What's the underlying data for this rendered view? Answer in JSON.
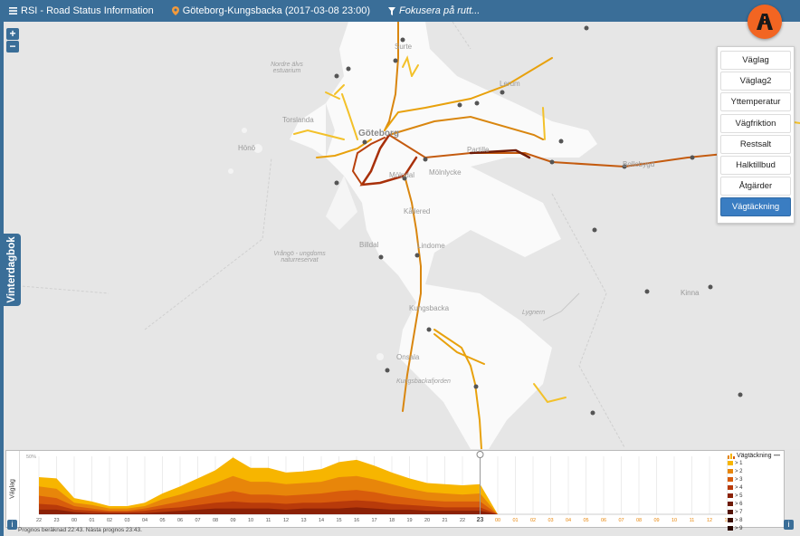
{
  "header": {
    "app_title": "RSI - Road Status Information",
    "location": "Göteborg-Kungsbacka (2017-03-08 23:00)",
    "focus": "Fokusera på rutt..."
  },
  "zoom": {
    "in": "+",
    "out": "−"
  },
  "layers": [
    {
      "label": "Väglag",
      "active": false
    },
    {
      "label": "Väglag2",
      "active": false
    },
    {
      "label": "Yttemperatur",
      "active": false
    },
    {
      "label": "Vägfriktion",
      "active": false
    },
    {
      "label": "Restsalt",
      "active": false
    },
    {
      "label": "Halktillbud",
      "active": false
    },
    {
      "label": "Åtgärder",
      "active": false
    },
    {
      "label": "Vägtäckning",
      "active": true
    }
  ],
  "side_tab": "Vinterdagbok",
  "map_labels": {
    "surte": "Surte",
    "nordre": "Nordre älvs estuarium",
    "lerum": "Lerum",
    "torslanda": "Torslanda",
    "hono": "Hönö",
    "goteborg": "Göteborg",
    "partille": "Partille",
    "mollerud": "Mölndal",
    "molnlycke": "Mölnlycke",
    "bollebygd": "Bollebygd",
    "kallered": "Kållered",
    "billdal": "Billdal",
    "lindome": "Lindome",
    "vrango": "Vrångö - ungdoms naturreservat",
    "kungsbacka": "Kungsbacka",
    "lygnern": "Lygnern",
    "kinna": "Kinna",
    "onsala": "Onsala",
    "kungsbackafjorden": "Kungsbackafjorden"
  },
  "bottom_panel": {
    "side_tab": "Väglag",
    "ymax_label": "50%",
    "current_hour": "23",
    "hours_past": [
      "22",
      "23",
      "00",
      "01",
      "02",
      "03",
      "04",
      "05",
      "06",
      "07",
      "08",
      "09",
      "10",
      "11",
      "12",
      "13",
      "14",
      "15",
      "16",
      "17",
      "18",
      "19",
      "20",
      "21",
      "22",
      "23"
    ],
    "hours_future": [
      "00",
      "01",
      "02",
      "03",
      "04",
      "05",
      "06",
      "07",
      "08",
      "09",
      "10",
      "11",
      "12",
      "13"
    ]
  },
  "chart_data": {
    "type": "area",
    "title": "Vägtäckning",
    "ylim": [
      0,
      50
    ],
    "x": [
      "22",
      "23",
      "00",
      "01",
      "02",
      "03",
      "04",
      "05",
      "06",
      "07",
      "08",
      "09",
      "10",
      "11",
      "12",
      "13",
      "14",
      "15",
      "16",
      "17",
      "18",
      "19",
      "20",
      "21",
      "22",
      "23"
    ],
    "series": [
      {
        "name": "> 1",
        "values": [
          32,
          31,
          14,
          11,
          7,
          7,
          10,
          18,
          24,
          31,
          38,
          49,
          40,
          40,
          36,
          37,
          39,
          45,
          47,
          42,
          36,
          31,
          27,
          26,
          25,
          26
        ]
      },
      {
        "name": "> 2",
        "values": [
          24,
          22,
          10,
          8,
          5,
          5,
          7,
          13,
          17,
          22,
          27,
          33,
          28,
          28,
          26,
          27,
          28,
          32,
          33,
          30,
          26,
          22,
          19,
          18,
          17,
          18
        ]
      },
      {
        "name": "> 3",
        "values": [
          16,
          14,
          7,
          5,
          3,
          3,
          5,
          8,
          11,
          14,
          17,
          20,
          17,
          17,
          16,
          17,
          18,
          20,
          21,
          19,
          16,
          14,
          12,
          11,
          11,
          11
        ]
      },
      {
        "name": "> 4",
        "values": [
          9,
          8,
          4,
          3,
          2,
          2,
          3,
          5,
          6,
          8,
          10,
          11,
          10,
          10,
          9,
          10,
          10,
          11,
          12,
          11,
          9,
          8,
          7,
          6,
          6,
          6
        ]
      },
      {
        "name": "> 5",
        "values": [
          4,
          4,
          2,
          1,
          1,
          1,
          1,
          2,
          3,
          4,
          5,
          5,
          5,
          5,
          4,
          5,
          5,
          5,
          6,
          5,
          4,
          4,
          3,
          3,
          3,
          3
        ]
      }
    ],
    "legend": [
      "> 1",
      "> 2",
      "> 3",
      "> 4",
      "> 5",
      "> 6",
      "> 7",
      "> 8",
      "> 9"
    ],
    "colors": [
      "#f7b500",
      "#e8860a",
      "#d85c0c",
      "#b83a0a",
      "#8b2106",
      "#6e1a05",
      "#541304",
      "#3d0d02",
      "#2a0801"
    ]
  },
  "status": "Prognos beräknad 22:43. Nästa prognos 23:43."
}
